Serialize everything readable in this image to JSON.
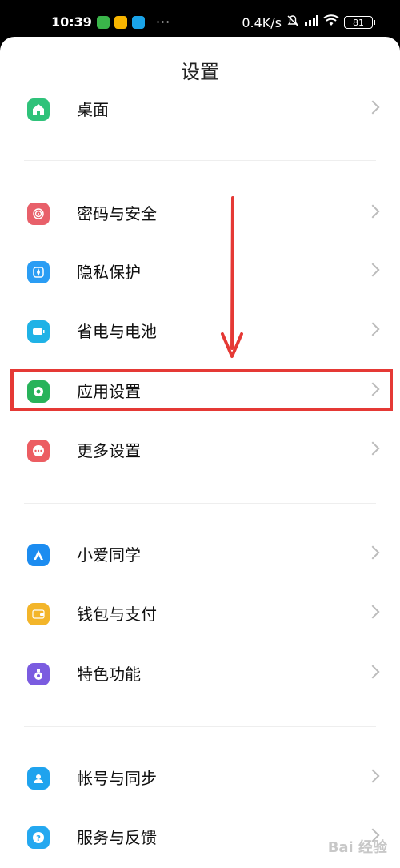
{
  "status_bar": {
    "time": "10:39",
    "app_icons": [
      "download-icon",
      "emoji-app-icon",
      "video-app-icon"
    ],
    "more": "···",
    "network_speed": "0.4K/s",
    "battery": "81"
  },
  "title": "设置",
  "sections": [
    {
      "items": [
        {
          "label": "桌面",
          "icon": "home-icon",
          "color": "#2fc27a"
        }
      ]
    },
    {
      "items": [
        {
          "label": "密码与安全",
          "icon": "fingerprint-icon",
          "color": "#e8606a"
        },
        {
          "label": "隐私保护",
          "icon": "compass-icon",
          "color": "#2a9df4"
        },
        {
          "label": "省电与电池",
          "icon": "battery-icon",
          "color": "#1fb2e6"
        },
        {
          "label": "应用设置",
          "icon": "gear-icon",
          "color": "#27b35a"
        },
        {
          "label": "更多设置",
          "icon": "more-icon",
          "color": "#ec5d62"
        }
      ]
    },
    {
      "items": [
        {
          "label": "小爱同学",
          "icon": "assistant-icon",
          "color": "#1c8cf0"
        },
        {
          "label": "钱包与支付",
          "icon": "wallet-icon",
          "color": "#f3b52a"
        },
        {
          "label": "特色功能",
          "icon": "flask-icon",
          "color": "#7b5ce0"
        }
      ]
    },
    {
      "items": [
        {
          "label": "帐号与同步",
          "icon": "account-icon",
          "color": "#1fa3ee"
        },
        {
          "label": "服务与反馈",
          "icon": "help-icon",
          "color": "#24a8f0"
        }
      ]
    }
  ],
  "annotation": {
    "highlighted_item": "应用设置",
    "arrow_color": "#e53935"
  },
  "watermark": "Bai 经验"
}
